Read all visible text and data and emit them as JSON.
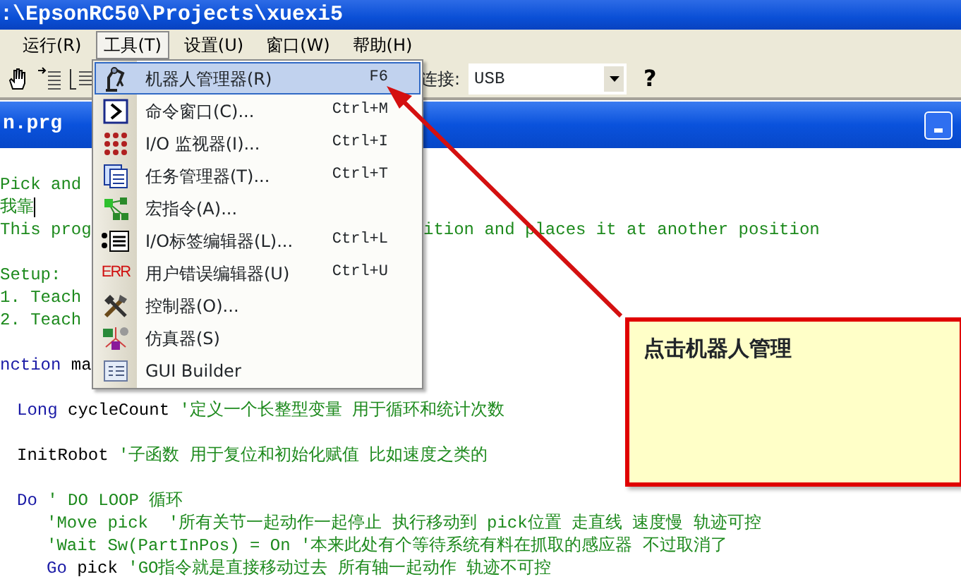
{
  "window": {
    "title": ":\\EpsonRC50\\Projects\\xuexi5"
  },
  "menu_bar": [
    {
      "label": "运行(R)",
      "selected": false
    },
    {
      "label": "工具(T)",
      "selected": true
    },
    {
      "label": "设置(U)",
      "selected": false
    },
    {
      "label": "窗口(W)",
      "selected": false
    },
    {
      "label": "帮助(H)",
      "selected": false
    }
  ],
  "toolbar": {
    "connection_label": "连接:",
    "connection_value": "USB",
    "help_button": "?"
  },
  "tools_menu": [
    {
      "label": "机器人管理器(R)",
      "shortcut": "F6",
      "selected": true
    },
    {
      "label": "命令窗口(C)...",
      "shortcut": "Ctrl+M",
      "selected": false
    },
    {
      "label": "I/O 监视器(I)...",
      "shortcut": "Ctrl+I",
      "selected": false
    },
    {
      "label": "任务管理器(T)...",
      "shortcut": "Ctrl+T",
      "selected": false
    },
    {
      "label": "宏指令(A)...",
      "selected": false
    },
    {
      "label": "I/O标签编辑器(L)...",
      "shortcut": "Ctrl+L",
      "selected": false
    },
    {
      "label": "用户错误编辑器(U)",
      "shortcut": "Ctrl+U",
      "selected": false,
      "icon_text": "ERR"
    },
    {
      "label": "控制器(O)...",
      "selected": false
    },
    {
      "label": "仿真器(S)",
      "selected": false
    },
    {
      "label": "GUI Builder",
      "selected": false
    }
  ],
  "editor": {
    "title": "n.prg",
    "lines": [
      {
        "kind": "code",
        "segments": [
          {
            "kind": "comment",
            "text": "Pick and"
          }
        ]
      },
      {
        "kind": "code",
        "caret": true,
        "segments": [
          {
            "kind": "comment",
            "text": "我靠"
          }
        ]
      },
      {
        "kind": "split",
        "segments": [
          {
            "kind": "comment",
            "text": "This prog"
          },
          {
            "kind": "comment",
            "text": "ition and places it at another position"
          }
        ]
      },
      {
        "kind": "blank"
      },
      {
        "kind": "code",
        "segments": [
          {
            "kind": "comment",
            "text": "Setup:"
          }
        ]
      },
      {
        "kind": "code",
        "segments": [
          {
            "kind": "comment",
            "text": "1. Teach"
          }
        ]
      },
      {
        "kind": "code",
        "segments": [
          {
            "kind": "comment",
            "text": "2. Teach"
          }
        ]
      },
      {
        "kind": "blank"
      },
      {
        "kind": "code",
        "segments": [
          {
            "kind": "keyword",
            "text": "nction"
          },
          {
            "kind": "plain",
            "text": " ma"
          }
        ],
        "children": [
          {
            "kind": "blank"
          },
          {
            "kind": "code",
            "segments": [
              {
                "kind": "keyword",
                "text": "Long"
              },
              {
                "kind": "plain",
                "text": " cycleCount "
              },
              {
                "kind": "comment",
                "text": "'定义一个长整型变量 用于循环和统计次数"
              }
            ]
          },
          {
            "kind": "blank"
          },
          {
            "kind": "code",
            "segments": [
              {
                "kind": "plain",
                "text": "InitRobot "
              },
              {
                "kind": "comment",
                "text": "'子函数 用于复位和初始化赋值 比如速度之类的"
              }
            ]
          },
          {
            "kind": "blank"
          },
          {
            "kind": "code",
            "segments": [
              {
                "kind": "keyword",
                "text": "Do"
              },
              {
                "kind": "comment",
                "text": " ' DO LOOP 循环"
              }
            ],
            "children": [
              {
                "kind": "code",
                "segments": [
                  {
                    "kind": "comment",
                    "text": "'Move pick  '所有关节一起动作一起停止 执行移动到 pick位置 走直线 速度慢 轨迹可控"
                  }
                ]
              },
              {
                "kind": "code",
                "segments": [
                  {
                    "kind": "comment",
                    "text": "'Wait Sw(PartInPos) = On '本来此处有个等待系统有料在抓取的感应器 不过取消了"
                  }
                ]
              },
              {
                "kind": "code",
                "segments": [
                  {
                    "kind": "keyword",
                    "text": "Go"
                  },
                  {
                    "kind": "plain",
                    "text": " pick "
                  },
                  {
                    "kind": "comment",
                    "text": "'GO指令就是直接移动过去 所有轴一起动作 轨迹不可控"
                  }
                ]
              }
            ]
          }
        ]
      }
    ]
  },
  "callout": {
    "text": "点击机器人管理"
  }
}
